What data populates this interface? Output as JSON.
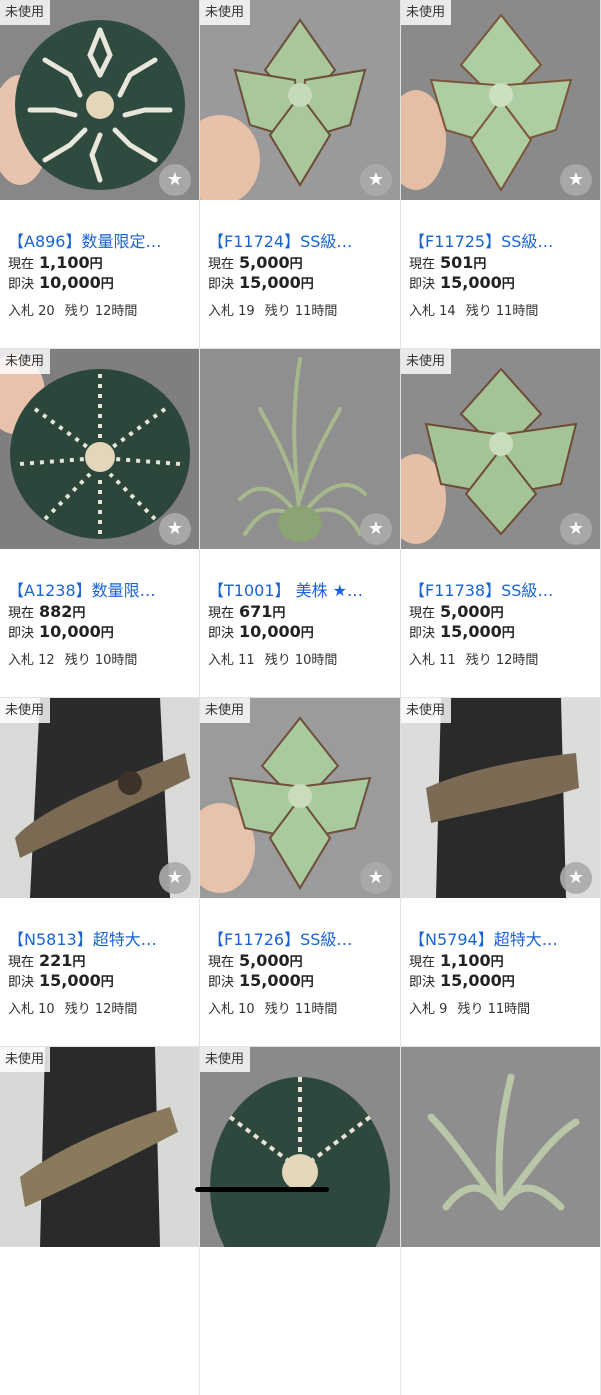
{
  "labels": {
    "badge": "未使用",
    "current": "現在",
    "buy_now": "即決",
    "bids": "入札",
    "remaining": "残り",
    "yen": "円"
  },
  "items": [
    {
      "title": "【A896】数量限定…",
      "current": "1,100",
      "buy_now": "10,000",
      "bids": "20",
      "remaining": "12時間",
      "image": "astrophytum-cactus",
      "badge": true
    },
    {
      "title": "【F11724】SS級…",
      "current": "5,000",
      "buy_now": "15,000",
      "bids": "19",
      "remaining": "11時間",
      "image": "agave-rosette",
      "badge": true
    },
    {
      "title": "【F11725】SS級…",
      "current": "501",
      "buy_now": "15,000",
      "bids": "14",
      "remaining": "11時間",
      "image": "agave-rosette",
      "badge": true
    },
    {
      "title": "【A1238】数量限…",
      "current": "882",
      "buy_now": "10,000",
      "bids": "12",
      "remaining": "10時間",
      "image": "astrophytum-cactus",
      "badge": true
    },
    {
      "title": "【T1001】 美株 ★…",
      "current": "671",
      "buy_now": "10,000",
      "bids": "11",
      "remaining": "10時間",
      "image": "air-plant",
      "badge": false
    },
    {
      "title": "【F11738】SS級…",
      "current": "5,000",
      "buy_now": "15,000",
      "bids": "11",
      "remaining": "12時間",
      "image": "agave-rosette",
      "badge": true
    },
    {
      "title": "【N5813】超特大…",
      "current": "221",
      "buy_now": "15,000",
      "bids": "10",
      "remaining": "12時間",
      "image": "cork-bark",
      "badge": true
    },
    {
      "title": "【F11726】SS級…",
      "current": "5,000",
      "buy_now": "15,000",
      "bids": "10",
      "remaining": "11時間",
      "image": "agave-rosette",
      "badge": true
    },
    {
      "title": "【N5794】超特大…",
      "current": "1,100",
      "buy_now": "15,000",
      "bids": "9",
      "remaining": "11時間",
      "image": "cork-bark",
      "badge": true
    },
    {
      "image": "cork-bark",
      "badge": true
    },
    {
      "image": "astrophytum-cactus",
      "badge": true
    },
    {
      "image": "air-plant",
      "badge": false
    }
  ]
}
